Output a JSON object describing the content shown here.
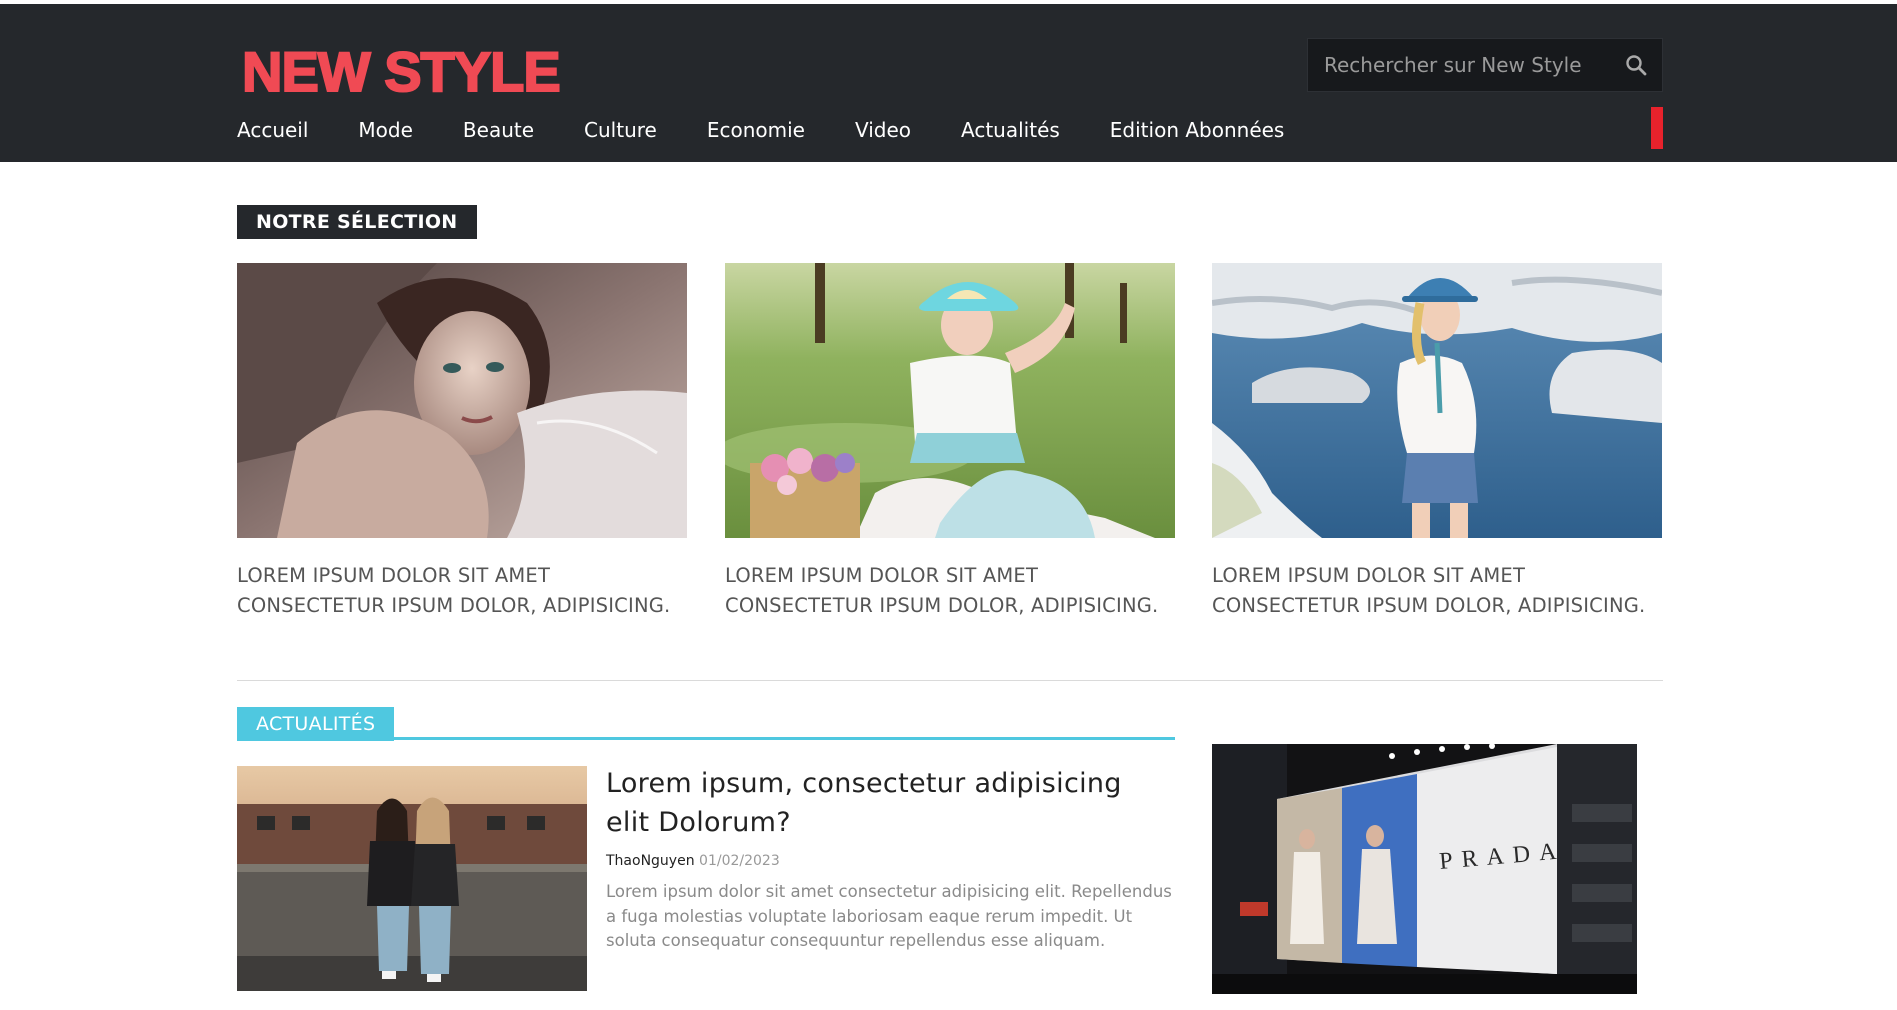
{
  "header": {
    "logo": "NEW STYLE",
    "search_placeholder": "Rechercher sur New Style",
    "nav": [
      "Accueil",
      "Mode",
      "Beaute",
      "Culture",
      "Economie",
      "Video",
      "Actualités",
      "Edition Abonnées"
    ]
  },
  "selection": {
    "label": "NOTRE SÉLECTION",
    "cards": [
      {
        "image": "woman-portrait-photo",
        "caption_line1": "LOREM IPSUM DOLOR SIT AMET",
        "caption_line2": "CONSECTETUR IPSUM DOLOR, ADIPISICING."
      },
      {
        "image": "woman-in-park-photo",
        "caption_line1": "LOREM IPSUM DOLOR SIT AMET",
        "caption_line2": "CONSECTETUR IPSUM DOLOR, ADIPISICING."
      },
      {
        "image": "woman-by-sea-photo",
        "caption_line1": "LOREM IPSUM DOLOR SIT AMET",
        "caption_line2": "CONSECTETUR IPSUM DOLOR, ADIPISICING."
      }
    ]
  },
  "news": {
    "label": "ACTUALITÉS",
    "article": {
      "image": "two-women-rooftop-photo",
      "title": "Lorem ipsum, consectetur adipisicing elit Dolorum?",
      "author": "ThaoNguyen",
      "date": "01/02/2023",
      "body": "Lorem ipsum dolor sit amet consectetur adipisicing elit. Repellendus a fuga molestias voluptate laboriosam eaque rerum impedit. Ut soluta consequatur consequuntur repellendus esse aliquam."
    },
    "side_image": "prada-billboard-photo",
    "billboard_text": "PRADA"
  },
  "colors": {
    "header_bg": "#25282c",
    "logo": "#f04a54",
    "accent_red": "#e8222c",
    "accent_cyan": "#4fc8e0"
  }
}
